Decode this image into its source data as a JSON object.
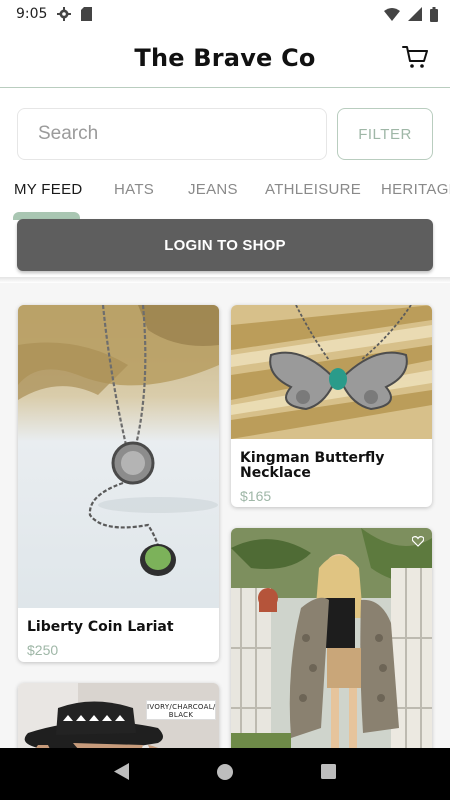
{
  "status_bar": {
    "time": "9:05",
    "left_icons": [
      "gear-icon",
      "sd-card-icon"
    ],
    "right_icons": [
      "wifi-icon",
      "signal-icon",
      "battery-icon"
    ]
  },
  "header": {
    "title": "The Brave Co",
    "cart_icon": "cart-icon"
  },
  "search": {
    "placeholder": "Search",
    "value": "",
    "filter_label": "FILTER"
  },
  "tabs": [
    {
      "label": "MY FEED",
      "active": true
    },
    {
      "label": "HATS",
      "active": false
    },
    {
      "label": "JEANS",
      "active": false
    },
    {
      "label": "ATHLEISURE",
      "active": false
    },
    {
      "label": "HERITAGE",
      "active": false
    }
  ],
  "login_banner": {
    "label": "LOGIN TO SHOP"
  },
  "products": [
    {
      "name": "Liberty Coin Lariat",
      "price": "$250",
      "image": "necklace-coin-lariat-photo"
    },
    {
      "name": "Kingman Butterfly Necklace",
      "price": "$165",
      "image": "butterfly-necklace-photo"
    },
    {
      "name": "",
      "price": "",
      "image": "woman-kimono-photo",
      "icon": "heart-icon"
    },
    {
      "name": "",
      "price": "",
      "image": "hat-photo",
      "tag_text": "IVORY/CHARCOAL/ BLACK"
    }
  ],
  "colors": {
    "accent": "#9fb7a7",
    "tab_indicator": "#a9c6b2",
    "banner": "#5e5e5e",
    "feed_background": "#f6f6f6"
  },
  "nav_bar": {
    "icons": [
      "back-icon",
      "home-icon",
      "recents-icon"
    ]
  }
}
